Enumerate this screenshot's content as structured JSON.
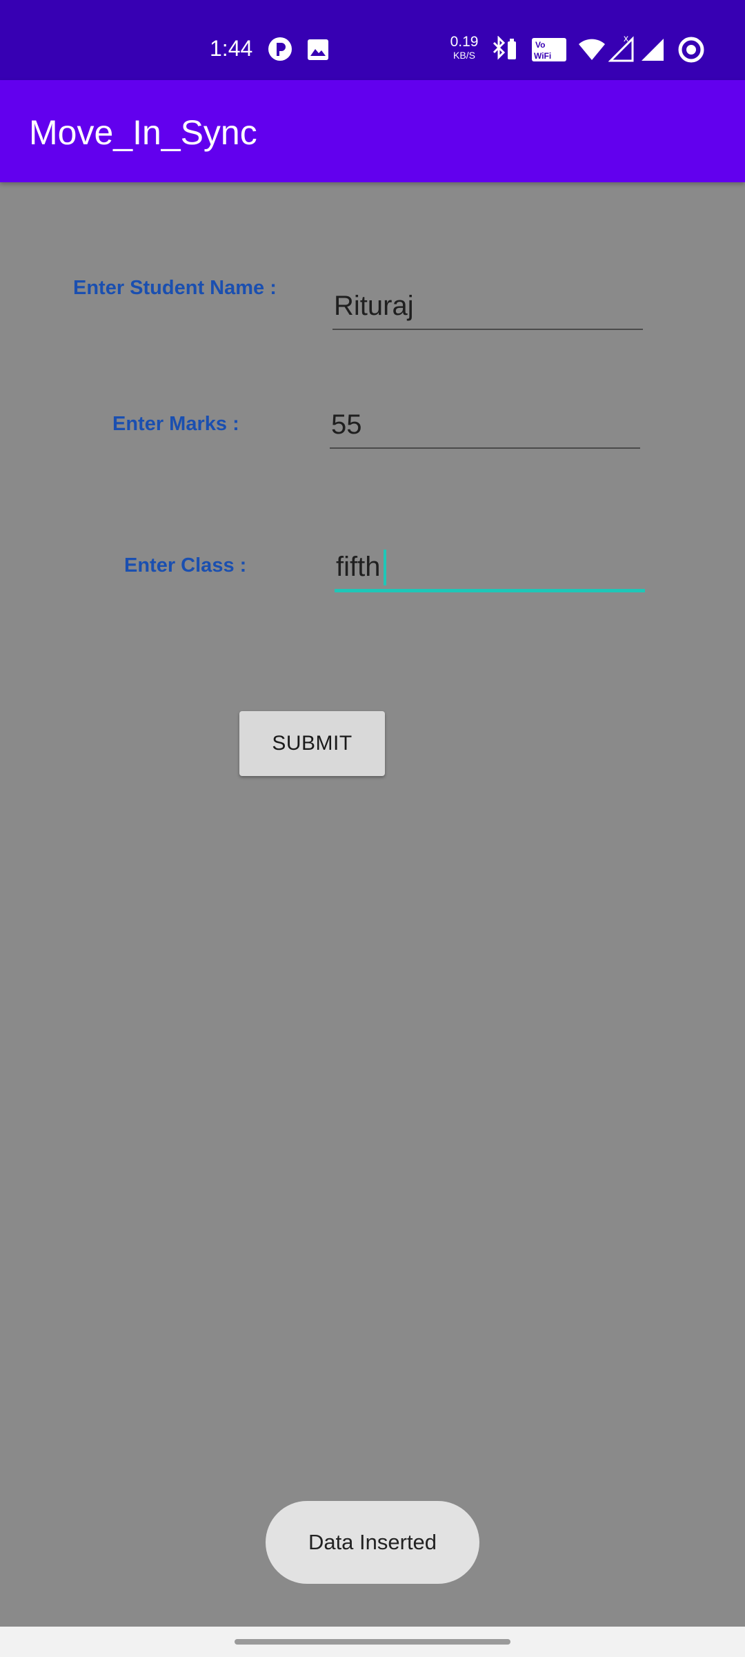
{
  "status_bar": {
    "time": "1:44",
    "net_speed_value": "0.19",
    "net_speed_unit": "KB/S",
    "icons": [
      "notification-p-icon",
      "gallery-icon",
      "bluetooth-battery-icon",
      "vowifi-icon",
      "wifi-icon",
      "signal-x-icon",
      "signal-icon",
      "sync-ring-icon"
    ]
  },
  "app_bar": {
    "title": "Move_In_Sync"
  },
  "form": {
    "name_label": "Enter Student Name :",
    "name_value": "Rituraj",
    "marks_label": "Enter Marks :",
    "marks_value": "55",
    "class_label": "Enter Class :",
    "class_value": "fifth",
    "submit_label": "SUBMIT"
  },
  "toast": {
    "message": "Data Inserted"
  },
  "colors": {
    "status_bar": "#3700b3",
    "app_bar": "#6200ee",
    "label": "#1a4fb0",
    "focus_accent": "#1ec7b8",
    "background": "#8a8a8a"
  }
}
